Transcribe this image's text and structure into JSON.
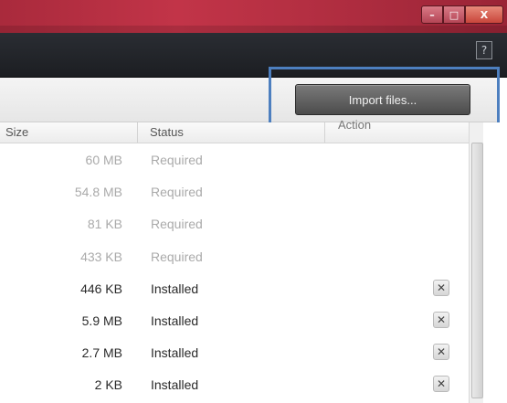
{
  "window": {
    "buttons": {
      "minimize": "–",
      "maximize": "□",
      "close": "X"
    },
    "help_label": "?"
  },
  "toolbar": {
    "import_label": "Import files..."
  },
  "table": {
    "headers": {
      "size": "Size",
      "status": "Status",
      "action": "Action"
    },
    "rows": [
      {
        "size": "60 MB",
        "status": "Required",
        "removable": false
      },
      {
        "size": "54.8 MB",
        "status": "Required",
        "removable": false
      },
      {
        "size": "81 KB",
        "status": "Required",
        "removable": false
      },
      {
        "size": "433 KB",
        "status": "Required",
        "removable": false
      },
      {
        "size": "446 KB",
        "status": "Installed",
        "removable": true
      },
      {
        "size": "5.9 MB",
        "status": "Installed",
        "removable": true
      },
      {
        "size": "2.7 MB",
        "status": "Installed",
        "removable": true
      },
      {
        "size": "2 KB",
        "status": "Installed",
        "removable": true
      }
    ],
    "remove_glyph": "✕"
  },
  "colors": {
    "titlebar": "#b42f42",
    "header_bar": "#1c1e22",
    "highlight": "#4d7fbf"
  },
  "icons": {
    "help": "help-icon",
    "remove": "remove-icon"
  }
}
